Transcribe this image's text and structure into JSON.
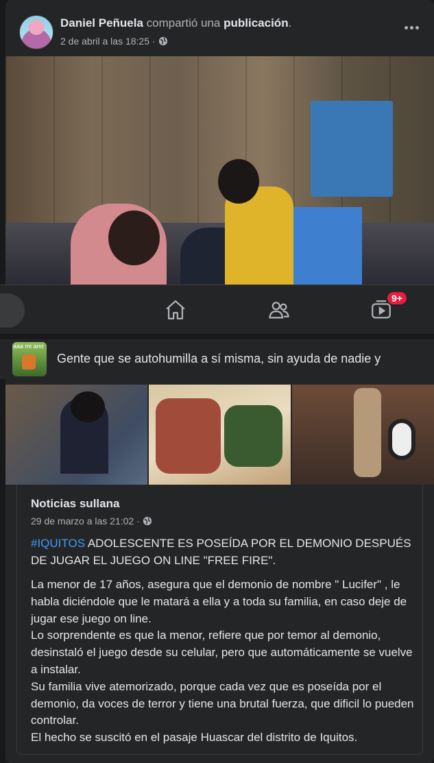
{
  "post": {
    "author": "Daniel Peñuela",
    "action_text": " compartió una ",
    "object_text": "publicación",
    "suffix": ".",
    "timestamp": "2 de abril a las 18:25 ·",
    "privacy_icon": "globe-icon",
    "more_icon": "more-options-icon"
  },
  "navbar": {
    "items": [
      {
        "icon": "home-icon"
      },
      {
        "icon": "friends-icon"
      },
      {
        "icon": "watch-icon",
        "badge": "9+"
      }
    ],
    "badge_color": "#e41e3f"
  },
  "shared": {
    "thumb_text": "aaa mi ano",
    "group_title": "Gente que se autohumilla a sí misma, sin ayuda de nadie y",
    "page_name": "Noticias sullana",
    "timestamp": "29 de marzo a las 21:02 ·",
    "hashtag": "#IQUITOS",
    "headline": " ADOLESCENTE ES POSEÍDA POR EL DEMONIO DESPUÉS DE JUGAR EL JUEGO ON LINE \"FREE FIRE\".",
    "body": "La menor de 17 años, asegura que el demonio de nombre \" Lucifer\" , le habla diciéndole que le matará a ella y a toda su familia, en caso deje  de jugar ese juego on line.\nLo sorprendente es que la menor, refiere que por temor al demonio, desinstaló el juego desde su celular, pero que automáticamente se vuelve a instalar.\nSu familia vive atemorizado, porque cada vez que es poseída por el demonio, da voces de terror y tiene una brutal fuerza, que dificil lo pueden controlar.\nEl hecho se suscitó en el pasaje Huascar del distrito de Iquitos."
  },
  "colors": {
    "background": "#18191a",
    "card": "#242526",
    "text_primary": "#e4e6eb",
    "text_secondary": "#b0b3b8",
    "link": "#4599ff"
  }
}
